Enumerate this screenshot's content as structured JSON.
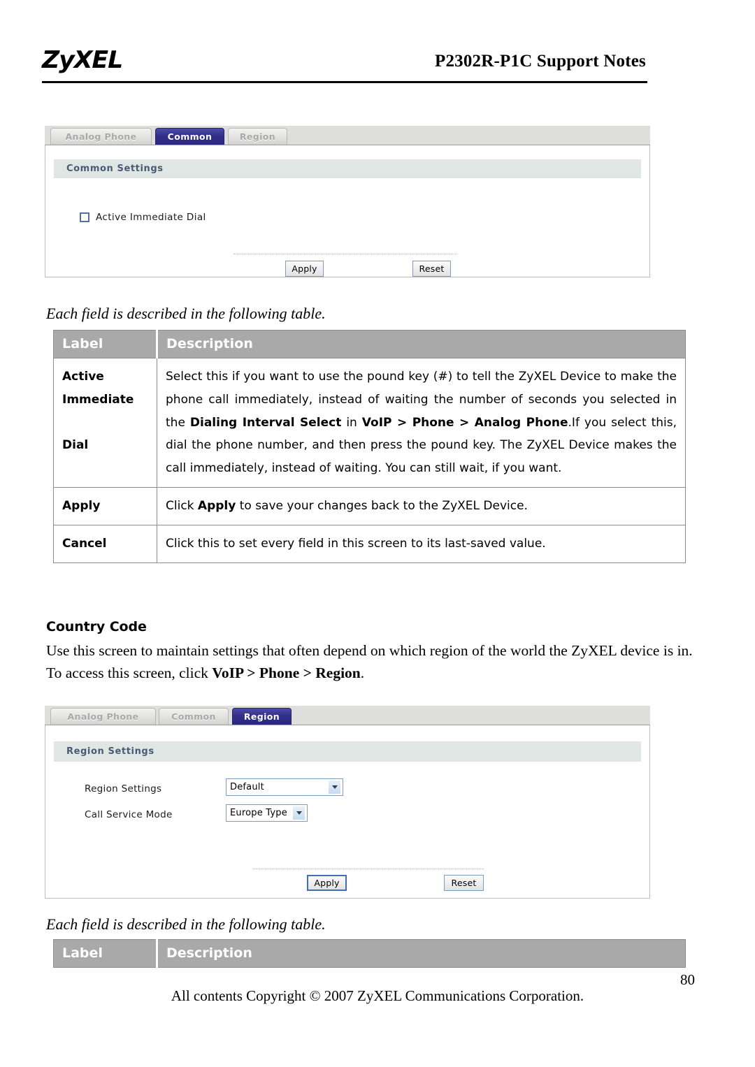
{
  "header": {
    "logo": "ZyXEL",
    "title": "P2302R-P1C Support Notes"
  },
  "screen_common": {
    "tabs": [
      {
        "label": "Analog Phone",
        "active": false
      },
      {
        "label": "Common",
        "active": true
      },
      {
        "label": "Region",
        "active": false
      }
    ],
    "section_title": "Common Settings",
    "checkbox_label": "Active Immediate Dial",
    "checkbox_checked": false,
    "apply_label": "Apply",
    "reset_label": "Reset"
  },
  "intro_text_1": "Each field is described in the following table.",
  "table_1": {
    "headers": [
      "Label",
      "Description"
    ],
    "rows": [
      {
        "label": "Active Immediate Dial",
        "label_lines": [
          "Active",
          "Immediate",
          "",
          "Dial"
        ],
        "description": "Select this if you want to use the pound key (#) to tell the ZyXEL Device to make the phone call immediately, instead of waiting the number of seconds you selected in the Dialing Interval Select in VoIP > Phone > Analog Phone.If you select this, dial the phone number, and then press the pound key. The ZyXEL Device makes the call immediately, instead of waiting. You can still wait, if you want."
      },
      {
        "label": "Apply",
        "description": "Click Apply to save your changes back to the ZyXEL Device."
      },
      {
        "label": "Cancel",
        "description": "Click this to set every field in this screen to its last-saved value."
      }
    ]
  },
  "country_code": {
    "heading": "Country Code",
    "paragraph_line1": "Use this screen to maintain settings that often depend on which region of the world the ZyXEL device is in.",
    "paragraph_line2_prefix": "To access this screen, click ",
    "paragraph_line2_path": "VoIP > Phone > Region",
    "paragraph_line2_suffix": "."
  },
  "screen_region": {
    "tabs": [
      {
        "label": "Analog Phone",
        "active": false
      },
      {
        "label": "Common",
        "active": false
      },
      {
        "label": "Region",
        "active": true
      }
    ],
    "section_title": "Region Settings",
    "fields": [
      {
        "label": "Region Settings",
        "value": "Default"
      },
      {
        "label": "Call Service Mode",
        "value": "Europe Type"
      }
    ],
    "apply_label": "Apply",
    "reset_label": "Reset"
  },
  "intro_text_2": "Each field is described in the following table.",
  "table_2": {
    "headers": [
      "Label",
      "Description"
    ]
  },
  "footer": {
    "page_number": "80",
    "copyright": "All contents Copyright © 2007 ZyXEL Communications Corporation."
  }
}
